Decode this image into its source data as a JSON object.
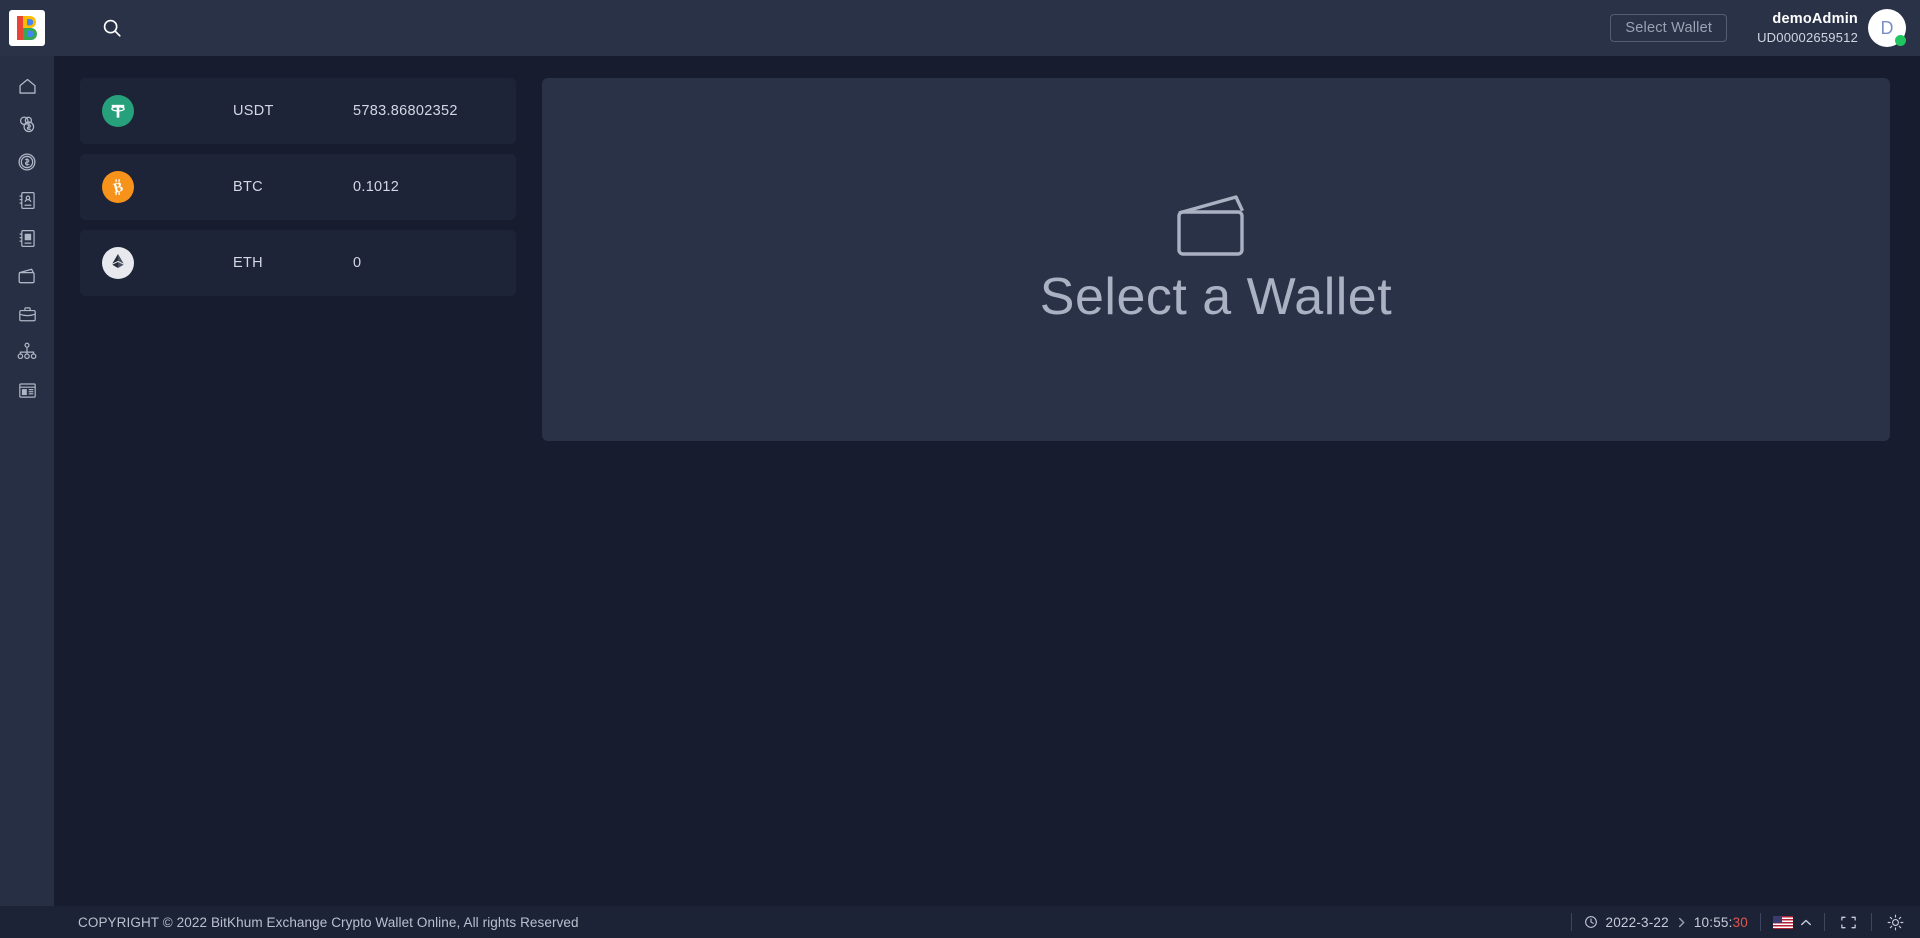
{
  "app": {
    "logo_letter": "B",
    "background_color": "#171d2e",
    "panel_color": "#2a3248",
    "sidebar_color": "#272f44"
  },
  "topbar": {
    "search_icon": "search-icon",
    "select_wallet_label": "Select Wallet",
    "user": {
      "name": "demoAdmin",
      "id": "UD00002659512",
      "avatar_letter": "D",
      "status_color": "#20c75e"
    }
  },
  "sidebar": {
    "items": [
      {
        "icon": "home-icon",
        "name": "sidebar-item-home"
      },
      {
        "icon": "coins-icon",
        "name": "sidebar-item-coins"
      },
      {
        "icon": "dollar-coin-icon",
        "name": "sidebar-item-currency"
      },
      {
        "icon": "address-book-icon",
        "name": "sidebar-item-address-book"
      },
      {
        "icon": "notebook-icon",
        "name": "sidebar-item-ledger"
      },
      {
        "icon": "wallet-icon",
        "name": "sidebar-item-wallet"
      },
      {
        "icon": "briefcase-icon",
        "name": "sidebar-item-portfolio"
      },
      {
        "icon": "org-chart-icon",
        "name": "sidebar-item-organization"
      },
      {
        "icon": "report-icon",
        "name": "sidebar-item-reports"
      }
    ]
  },
  "assets": [
    {
      "symbol": "USDT",
      "amount": "5783.86802352",
      "color": "#26a17b",
      "icon": "tether-icon"
    },
    {
      "symbol": "BTC",
      "amount": "0.1012",
      "color": "#f7931a",
      "icon": "bitcoin-icon"
    },
    {
      "symbol": "ETH",
      "amount": "0",
      "color": "#e7e9ee",
      "icon": "ethereum-icon"
    }
  ],
  "main": {
    "empty_state_icon": "wallet-outline-icon",
    "empty_state_title": "Select a Wallet"
  },
  "footer": {
    "copyright": "COPYRIGHT © 2022 BitKhum Exchange Crypto Wallet Online, All rights Reserved",
    "clock_icon": "clock-icon",
    "date": "2022-3-22",
    "separator": "›",
    "time_hm": "10:55:",
    "time_sec": "30",
    "language_flag": "us-flag-icon",
    "language_chevron": "chevron-up-icon",
    "fullscreen_icon": "fullscreen-icon",
    "brightness_icon": "brightness-icon"
  }
}
